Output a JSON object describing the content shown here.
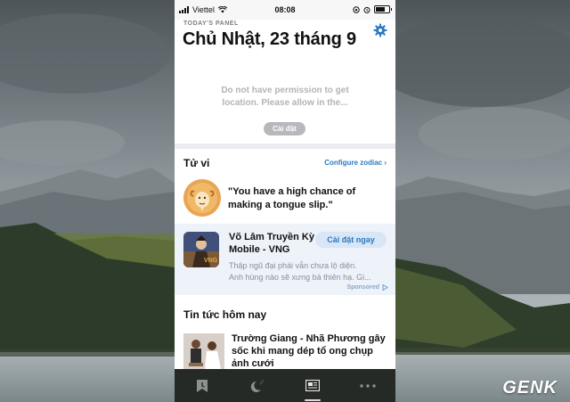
{
  "status_bar": {
    "carrier": "Viettel",
    "time": "08:08"
  },
  "panel": {
    "eyebrow": "TODAY'S PANEL",
    "date_title": "Chủ Nhật, 23 tháng 9",
    "location_line1": "Do not have permission to get",
    "location_line2": "location. Please allow in the...",
    "install_label": "Cài đặt"
  },
  "tuvi": {
    "heading": "Tử vi",
    "configure_link": "Configure zodiac ›",
    "quote": "\"You have a high chance of making a tongue slip.\""
  },
  "ad": {
    "title": "Võ Lâm Truyền Kỳ Mobile - VNG",
    "install_label": "Cài đặt ngay",
    "desc_line1": "Thập ngũ đại phái vẫn chưa lộ diện.",
    "desc_line2": "Anh hùng nào sẽ xưng bá thiên hạ. Gi...",
    "sponsored": "Sponsored",
    "logo_text": "VNG"
  },
  "news": {
    "heading": "Tin tức hôm nay",
    "item_title": "Trường Giang - Nhã Phương gây sốc khi mang dép tổ ong chụp ảnh cưới"
  },
  "tabs": [
    "today-tab",
    "night-tab",
    "news-tab",
    "more-tab"
  ],
  "watermark": "GENK",
  "colors": {
    "accent": "#2a7ac0",
    "tabbar": "#262a27",
    "ad_background": "#eef3fa"
  }
}
